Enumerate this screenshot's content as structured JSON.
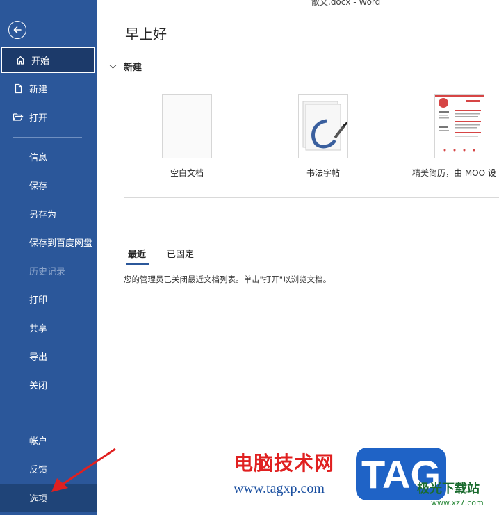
{
  "window": {
    "title": "散文.docx  -  Word"
  },
  "sidebar": {
    "items": [
      {
        "label": "开始",
        "icon": "home-icon"
      },
      {
        "label": "新建",
        "icon": "new-document-icon"
      },
      {
        "label": "打开",
        "icon": "open-folder-icon"
      },
      {
        "label": "信息"
      },
      {
        "label": "保存"
      },
      {
        "label": "另存为"
      },
      {
        "label": "保存到百度网盘"
      },
      {
        "label": "历史记录"
      },
      {
        "label": "打印"
      },
      {
        "label": "共享"
      },
      {
        "label": "导出"
      },
      {
        "label": "关闭"
      },
      {
        "label": "帐户"
      },
      {
        "label": "反馈"
      },
      {
        "label": "选项"
      }
    ]
  },
  "main": {
    "greeting": "早上好",
    "new_section": {
      "title": "新建"
    },
    "templates": [
      {
        "label": "空白文档"
      },
      {
        "label": "书法字帖"
      },
      {
        "label": "精美简历，由 MOO 设"
      }
    ],
    "tabs": [
      {
        "label": "最近"
      },
      {
        "label": "已固定"
      }
    ],
    "recent_info": "您的管理员已关闭最近文档列表。单击\"打开\"以浏览文档。"
  },
  "watermark": {
    "site_cn": "电脑技术网",
    "site_url": "www.tagxp.com",
    "tag": "TAG",
    "xz_name": "极光下载站",
    "xz_url": "www.xz7.com"
  },
  "colors": {
    "sidebar": "#2b579a",
    "accent": "#2b579a",
    "annotation_arrow": "#e02020"
  }
}
